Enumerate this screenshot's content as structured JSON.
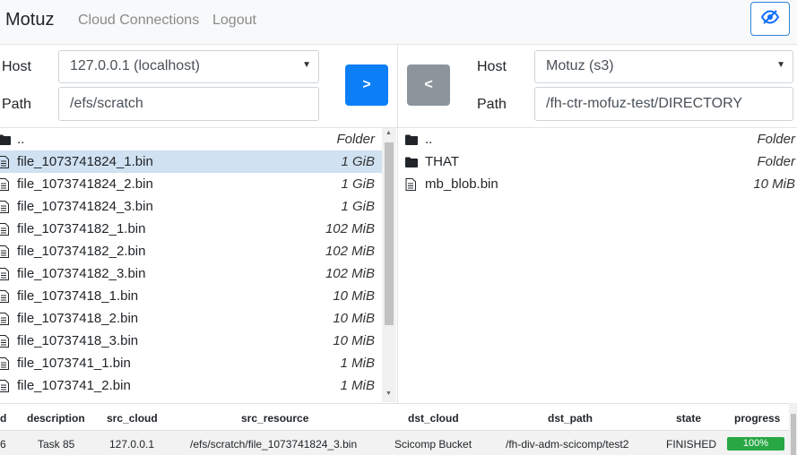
{
  "navbar": {
    "brand": "Motuz",
    "links": [
      "Cloud Connections",
      "Logout"
    ]
  },
  "left_pane": {
    "host_label": "Host",
    "host_value": "127.0.0.1 (localhost)",
    "path_label": "Path",
    "path_value": "/efs/scratch",
    "files": [
      {
        "name": "..",
        "size": "Folder",
        "type": "folder"
      },
      {
        "name": "file_1073741824_1.bin",
        "size": "1 GiB",
        "type": "file",
        "selected": true
      },
      {
        "name": "file_1073741824_2.bin",
        "size": "1 GiB",
        "type": "file"
      },
      {
        "name": "file_1073741824_3.bin",
        "size": "1 GiB",
        "type": "file"
      },
      {
        "name": "file_107374182_1.bin",
        "size": "102 MiB",
        "type": "file"
      },
      {
        "name": "file_107374182_2.bin",
        "size": "102 MiB",
        "type": "file"
      },
      {
        "name": "file_107374182_3.bin",
        "size": "102 MiB",
        "type": "file"
      },
      {
        "name": "file_10737418_1.bin",
        "size": "10 MiB",
        "type": "file"
      },
      {
        "name": "file_10737418_2.bin",
        "size": "10 MiB",
        "type": "file"
      },
      {
        "name": "file_10737418_3.bin",
        "size": "10 MiB",
        "type": "file"
      },
      {
        "name": "file_1073741_1.bin",
        "size": "1 MiB",
        "type": "file"
      },
      {
        "name": "file_1073741_2.bin",
        "size": "1 MiB",
        "type": "file"
      }
    ]
  },
  "transfer": {
    "copy_right_label": ">",
    "copy_left_label": "<"
  },
  "right_pane": {
    "host_label": "Host",
    "host_value": "Motuz (s3)",
    "path_label": "Path",
    "path_value": "/fh-ctr-mofuz-test/DIRECTORY",
    "files": [
      {
        "name": "..",
        "size": "Folder",
        "type": "folder"
      },
      {
        "name": "THAT",
        "size": "Folder",
        "type": "folder"
      },
      {
        "name": "mb_blob.bin",
        "size": "10 MiB",
        "type": "file"
      }
    ]
  },
  "tasks": {
    "headers": [
      "d",
      "description",
      "src_cloud",
      "src_resource",
      "dst_cloud",
      "dst_path",
      "state",
      "progress"
    ],
    "rows": [
      {
        "id": "6",
        "description": "Task 85",
        "src_cloud": "127.0.0.1",
        "src_resource": "/efs/scratch/file_1073741824_3.bin",
        "dst_cloud": "Scicomp Bucket",
        "dst_path": "/fh-div-adm-scicomp/test2",
        "state": "FINISHED",
        "progress": "100%"
      }
    ]
  },
  "colors": {
    "primary": "#0d7ff6",
    "secondary": "#8d959c",
    "success": "#28a745",
    "selected_row": "#d0e1f1"
  }
}
